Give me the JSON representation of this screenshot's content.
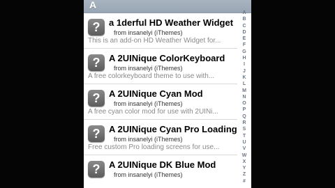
{
  "section_header": "A",
  "rows": [
    {
      "title": "a 1derful HD Weather Widget",
      "author": "from insanelyi (iThemes)",
      "desc": "This is an add-on HD Weather Widget for..."
    },
    {
      "title": "A 2UINique ColorKeyboard",
      "author": "from insanelyi (iThemes)",
      "desc": "A free colorkeyboard theme to use with..."
    },
    {
      "title": "A 2UINique Cyan Mod",
      "author": "from insanelyi (iThemes)",
      "desc": "A free cyan color mod for use with 2UINi..."
    },
    {
      "title": "A 2UINique Cyan Pro Loading",
      "author": "from insanelyi (iThemes)",
      "desc": "Free custom Pro loading screens for use..."
    },
    {
      "title": "A 2UINique DK Blue Mod",
      "author": "from insanelyi (iThemes)",
      "desc": ""
    }
  ],
  "index_letters": [
    "A",
    "B",
    "C",
    "D",
    "E",
    "F",
    "G",
    "H",
    "I",
    "J",
    "K",
    "L",
    "M",
    "N",
    "O",
    "P",
    "Q",
    "R",
    "S",
    "T",
    "U",
    "V",
    "W",
    "X",
    "Y",
    "Z",
    "#"
  ],
  "icon_glyph": "?"
}
